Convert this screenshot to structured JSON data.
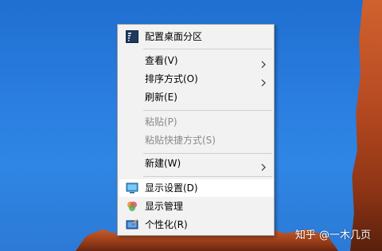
{
  "menu": {
    "items": [
      {
        "label": "配置桌面分区",
        "icon": "desktop-partition-icon"
      },
      {
        "label": "查看(V)",
        "has_submenu": true
      },
      {
        "label": "排序方式(O)",
        "has_submenu": true
      },
      {
        "label": "刷新(E)"
      },
      {
        "label": "粘贴(P)",
        "disabled": true
      },
      {
        "label": "粘贴快捷方式(S)",
        "disabled": true
      },
      {
        "label": "新建(W)",
        "has_submenu": true
      },
      {
        "label": "显示设置(D)",
        "icon": "display-settings-icon",
        "highlighted": true
      },
      {
        "label": "显示管理",
        "icon": "display-manager-icon"
      },
      {
        "label": "个性化(R)",
        "icon": "personalize-icon"
      }
    ]
  },
  "watermark": "知乎 @一木几页",
  "colors": {
    "menu_background": "#f2f2f2",
    "highlight_background": "#ffffff",
    "disabled_text": "#8a8a8a",
    "desktop_sky": "#2a7ee0",
    "rock": "#b84b22"
  }
}
